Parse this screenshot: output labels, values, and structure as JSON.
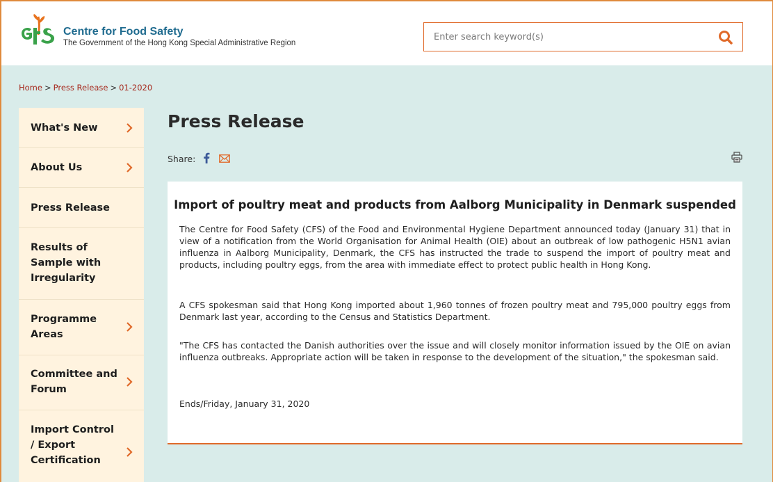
{
  "header": {
    "brand_title": "Centre for Food Safety",
    "brand_subtitle": "The Government of the Hong Kong Special Administrative Region",
    "logo_text": "cfs",
    "search": {
      "placeholder": "Enter search keyword(s)",
      "value": ""
    },
    "colors": {
      "accent": "#e06a2a",
      "brand": "#1f6b8f",
      "logo_green": "#3aa24a",
      "logo_orange": "#e8731e"
    }
  },
  "breadcrumb": {
    "items": [
      "Home",
      "Press Release",
      "01-2020"
    ],
    "separator": ">"
  },
  "sidebar": {
    "items": [
      {
        "label": "What's New",
        "chevron": true
      },
      {
        "label": "About Us",
        "chevron": true
      },
      {
        "label": "Press Release",
        "chevron": false
      },
      {
        "label": "Results of Sample with Irregularity",
        "chevron": false
      },
      {
        "label": "Programme Areas",
        "chevron": true
      },
      {
        "label": "Committee and Forum",
        "chevron": true
      },
      {
        "label": "Import Control / Export Certification",
        "chevron": true
      }
    ]
  },
  "main": {
    "page_title": "Press Release",
    "share_label": "Share:",
    "share_icons": [
      "facebook-icon",
      "mail-icon"
    ],
    "print_icon": "print-icon",
    "article": {
      "title": "Import of poultry meat and products from Aalborg Municipality in Denmark suspended",
      "paragraphs": [
        "The Centre for Food Safety (CFS) of the Food and Environmental Hygiene Department announced today (January 31) that in view of a notification from the World Organisation for Animal Health (OIE) about an outbreak of low pathogenic H5N1 avian influenza in Aalborg Municipality, Denmark, the CFS has instructed the trade to suspend the import of poultry meat and products, including poultry eggs, from the area with immediate effect to protect public health in Hong Kong.",
        "A CFS spokesman said that Hong Kong imported about 1,960 tonnes of frozen poultry meat and 795,000 poultry eggs from Denmark last year, according to the Census and Statistics Department.",
        "\"The CFS has contacted the Danish authorities over the issue and will closely monitor information issued by the OIE on avian influenza outbreaks. Appropriate action will be taken in response to the development of the situation,\" the spokesman said.",
        "Ends/Friday, January 31, 2020"
      ]
    }
  }
}
